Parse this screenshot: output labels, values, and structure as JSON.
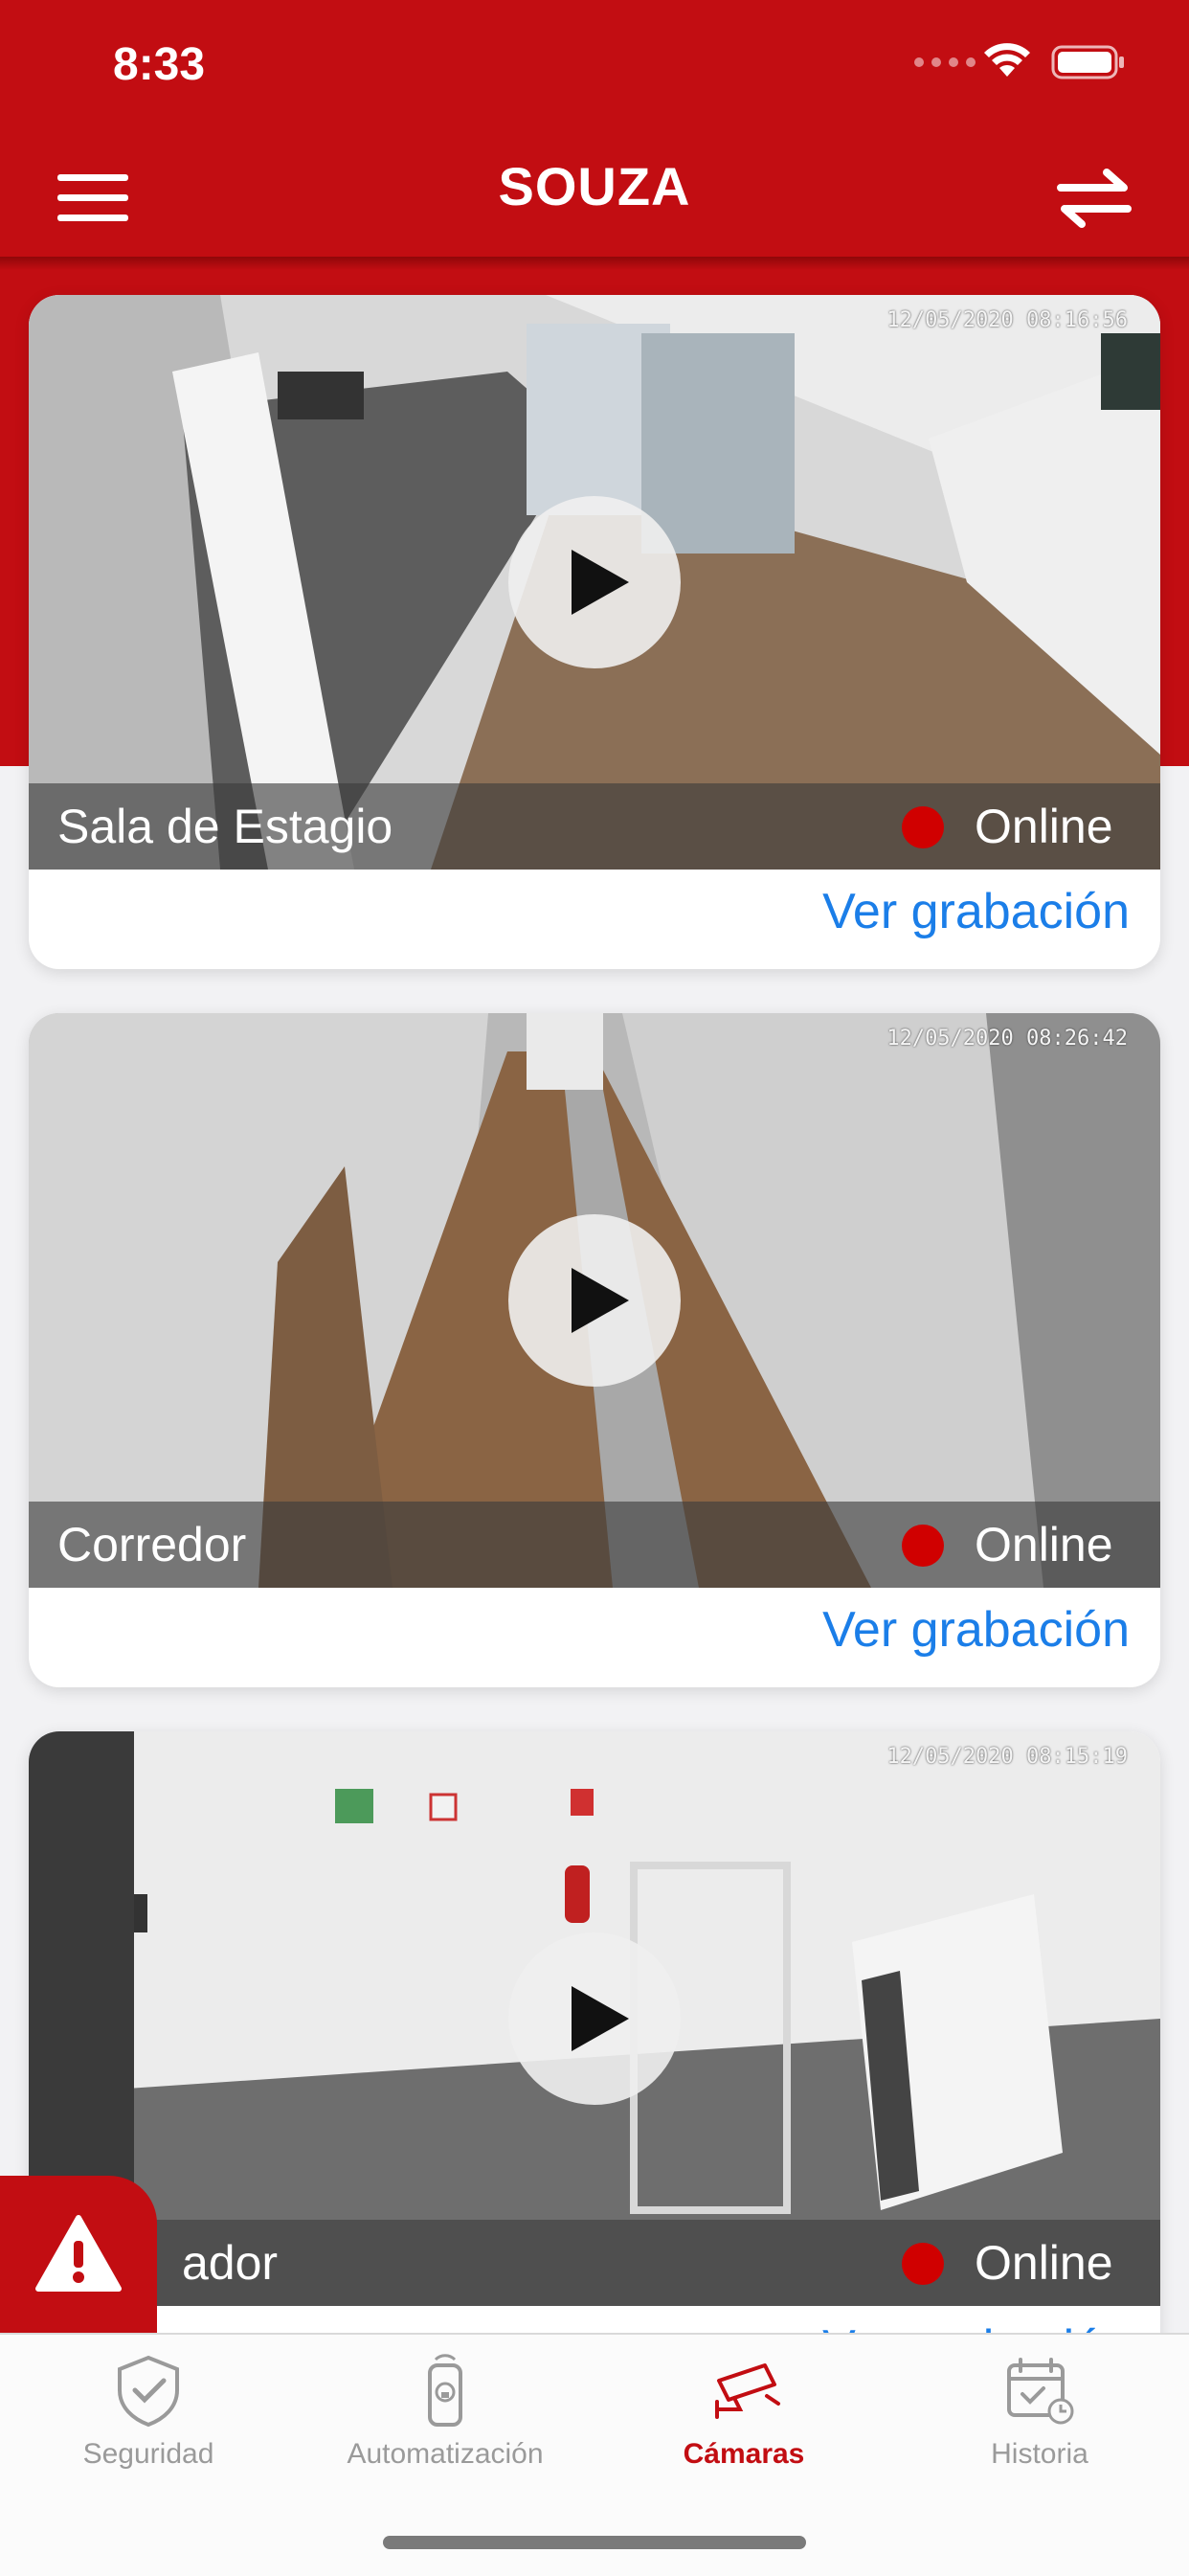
{
  "status_bar": {
    "time": "8:33"
  },
  "header": {
    "title": "SOUZA",
    "menu_icon": "hamburger-menu-icon",
    "swap_icon": "swap-arrows-icon"
  },
  "colors": {
    "brand_red": "#c20d12",
    "link_blue": "#1b7ee8",
    "status_online": "#d00000"
  },
  "cameras": [
    {
      "name": "Sala de Estagio",
      "status": "Online",
      "timestamp": "12/05/2020 08:16:56",
      "link": "Ver grabación"
    },
    {
      "name": "Corredor",
      "status": "Online",
      "timestamp": "12/05/2020 08:26:42",
      "link": "Ver grabación"
    },
    {
      "name": "ador",
      "status": "Online",
      "timestamp": "12/05/2020 08:15:19",
      "link": "Ver grabación"
    }
  ],
  "tabs": [
    {
      "label": "Seguridad",
      "icon": "shield-check-icon",
      "active": false
    },
    {
      "label": "Automatización",
      "icon": "remote-control-icon",
      "active": false
    },
    {
      "label": "Cámaras",
      "icon": "security-camera-icon",
      "active": true
    },
    {
      "label": "Historia",
      "icon": "calendar-history-icon",
      "active": false
    }
  ]
}
